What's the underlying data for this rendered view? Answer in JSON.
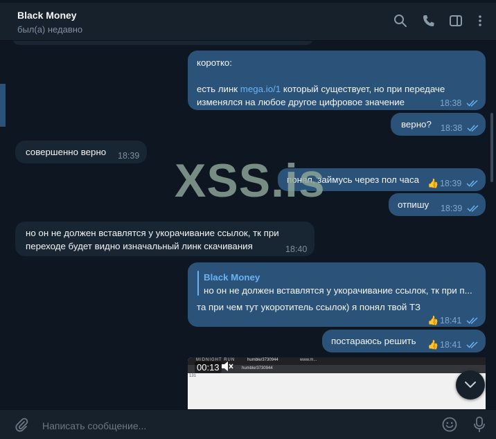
{
  "header": {
    "title": "Black Money",
    "status": "был(а) недавно",
    "icons": [
      "search-icon",
      "phone-icon",
      "sidebar-toggle-icon",
      "more-icon"
    ]
  },
  "messages": [
    {
      "dir": "out",
      "text_line1": "коротко:",
      "text_line2_pre": "есть линк ",
      "text_line2_link": "mega.io/1",
      "text_line2_post": " который существует, но при передаче",
      "text_line3": "изменялся на любое другое цифровое значение",
      "time": "18:38"
    },
    {
      "dir": "out",
      "text": "верно?",
      "time": "18:38"
    },
    {
      "dir": "in",
      "text": "совершенно верно",
      "time": "18:39"
    },
    {
      "dir": "out",
      "text": "понял, займусь через пол часа",
      "time": "18:39",
      "reaction": "👍"
    },
    {
      "dir": "out",
      "text": "отпишу",
      "time": "18:39"
    },
    {
      "dir": "in",
      "text_line1": "но он не должен вставлятся у укорачивание ссылок, тк при",
      "text_line2": "переходе будет видно изначальный линк скачивания",
      "time": "18:40"
    },
    {
      "dir": "out",
      "reply_author": "Black Money",
      "reply_text": "но он не должен вставлятся у укорачивание ссылок, тк при п...",
      "text": "та при чем тут укоротитель ссылок) я понял твой ТЗ",
      "time": "18:41",
      "reaction": "👍"
    },
    {
      "dir": "out",
      "text": "постараюсь решить",
      "time": "18:41",
      "reaction": "👍"
    }
  ],
  "video": {
    "duration": "00:13",
    "tab1": "MIDNIGHT RUN",
    "tab2": "humble/3730944",
    "tab3": "www.m...",
    "address": "humble/3730944",
    "page_text": "131"
  },
  "watermark": "XSS.is",
  "composer": {
    "placeholder": "Написать сообщение..."
  },
  "colors": {
    "background": "#0e1621",
    "bubble_in": "#182533",
    "bubble_out": "#2b5278",
    "accent": "#6ab3f3"
  }
}
